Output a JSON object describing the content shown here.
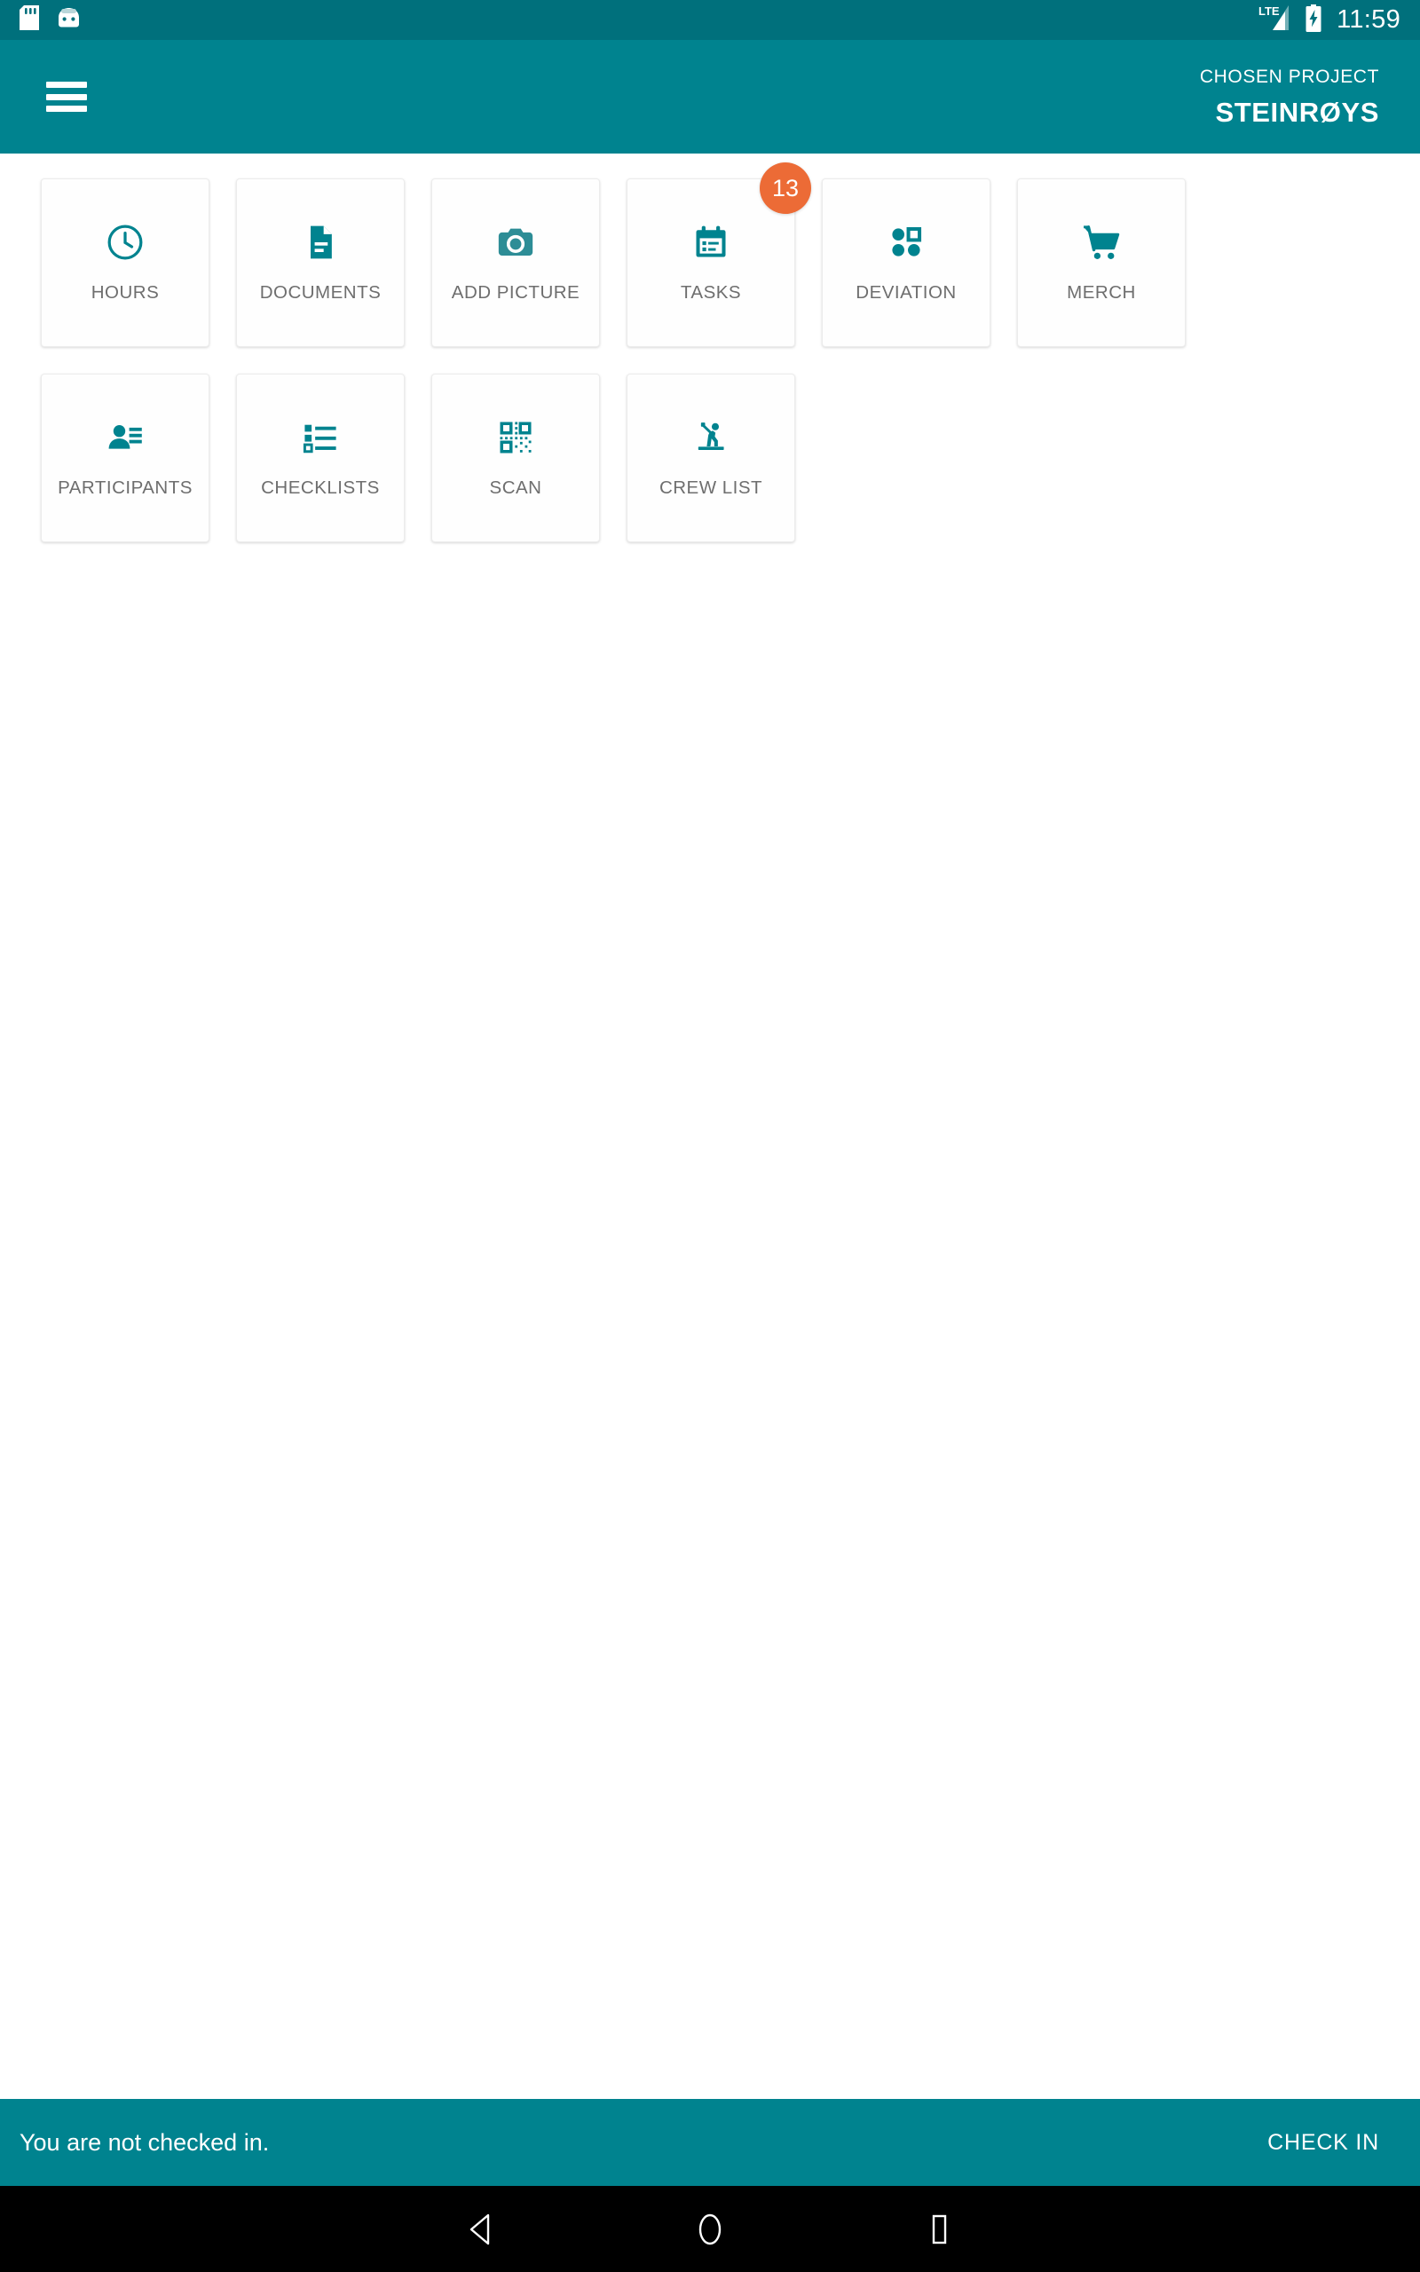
{
  "status_bar": {
    "left_icons": [
      "sd-card-icon",
      "android-head-icon"
    ],
    "network_label": "LTE",
    "battery_state": "charging",
    "time": "11:59",
    "background_color": "#00707C"
  },
  "app_bar": {
    "menu_icon": "hamburger-menu-icon",
    "kicker": "CHOSEN PROJECT",
    "project_name": "STEINRØYS",
    "background_color": "#00838F"
  },
  "theme": {
    "primary": "#00838F",
    "primary_dark": "#00707C",
    "badge": "#EC6B36",
    "tile_label": "#6e6e6e",
    "surface": "#ffffff"
  },
  "tiles": [
    {
      "label": "HOURS",
      "icon": "clock-icon",
      "badge": null
    },
    {
      "label": "DOCUMENTS",
      "icon": "document-icon",
      "badge": null
    },
    {
      "label": "ADD PICTURE",
      "icon": "camera-icon",
      "badge": null
    },
    {
      "label": "TASKS",
      "icon": "calendar-icon",
      "badge": "13"
    },
    {
      "label": "DEVIATION",
      "icon": "bubble-chart-icon",
      "badge": null
    },
    {
      "label": "MERCH",
      "icon": "shopping-cart-icon",
      "badge": null
    },
    {
      "label": "PARTICIPANTS",
      "icon": "contacts-icon",
      "badge": null
    },
    {
      "label": "CHECKLISTS",
      "icon": "list-icon",
      "badge": null
    },
    {
      "label": "SCAN",
      "icon": "qr-code-icon",
      "badge": null
    },
    {
      "label": "CREW LIST",
      "icon": "worker-icon",
      "badge": null
    }
  ],
  "checkin_bar": {
    "status_text": "You are not checked in.",
    "action_label": "CHECK IN"
  },
  "nav_bar": {
    "back": "back-triangle-icon",
    "home": "home-circle-icon",
    "recents": "recents-square-icon"
  }
}
